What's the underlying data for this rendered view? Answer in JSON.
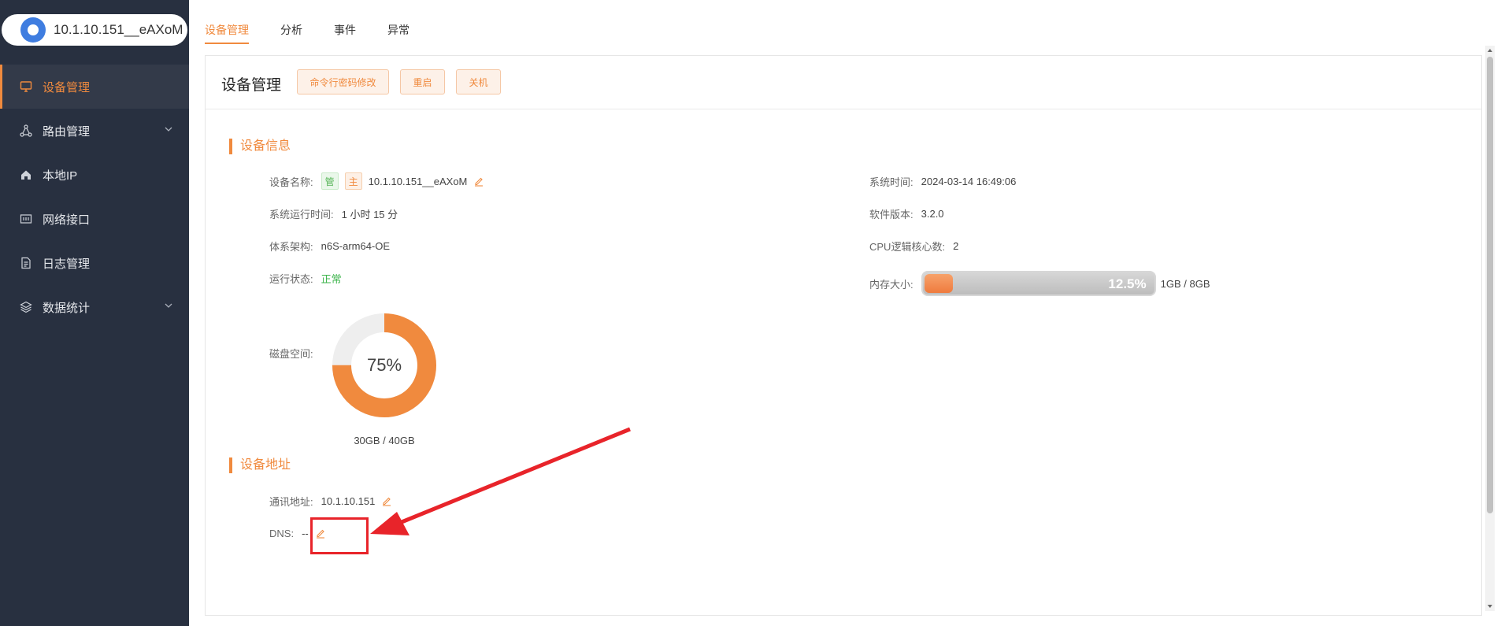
{
  "window": {
    "title": "10.1.10.151__eAXoM"
  },
  "sidebar": {
    "brand_title": "10.1.10.151__eAXoM",
    "items": [
      {
        "label": "设备管理",
        "icon": "monitor-icon",
        "active": true
      },
      {
        "label": "路由管理",
        "icon": "route-icon",
        "expandable": true
      },
      {
        "label": "本地IP",
        "icon": "home-icon"
      },
      {
        "label": "网络接口",
        "icon": "interface-icon"
      },
      {
        "label": "日志管理",
        "icon": "document-icon"
      },
      {
        "label": "数据统计",
        "icon": "layers-icon",
        "expandable": true
      }
    ]
  },
  "tabs": [
    {
      "label": "设备管理",
      "active": true
    },
    {
      "label": "分析"
    },
    {
      "label": "事件"
    },
    {
      "label": "异常"
    }
  ],
  "card": {
    "title": "设备管理",
    "buttons": {
      "cli_password": "命令行密码修改",
      "restart": "重启",
      "shutdown": "关机"
    }
  },
  "device_info": {
    "section_title": "设备信息",
    "name_label": "设备名称:",
    "tag_manage": "管",
    "tag_master": "主",
    "name_value": "10.1.10.151__eAXoM",
    "uptime_label": "系统运行时间:",
    "uptime_value": "1 小时 15 分",
    "arch_label": "体系架构:",
    "arch_value": "n6S-arm64-OE",
    "status_label": "运行状态:",
    "status_value": "正常",
    "system_time_label": "系统时间:",
    "system_time_value": "2024-03-14 16:49:06",
    "software_version_label": "软件版本:",
    "software_version_value": "3.2.0",
    "cpu_cores_label": "CPU逻辑核心数:",
    "cpu_cores_value": "2",
    "memory_label": "内存大小:",
    "memory_percent_text": "12.5%",
    "memory_fraction": 0.125,
    "memory_usage_text": "1GB / 8GB",
    "disk_label": "磁盘空间:",
    "disk_percent_text": "75%",
    "disk_fraction": 0.75,
    "disk_usage_text": "30GB / 40GB"
  },
  "device_address": {
    "section_title": "设备地址",
    "comm_label": "通讯地址:",
    "comm_value": "10.1.10.151",
    "dns_label": "DNS:",
    "dns_value": "--"
  },
  "colors": {
    "accent": "#f08a3e",
    "sidebar_bg": "#283040",
    "status_ok": "#3cb44b",
    "annotation_red": "#e8242a"
  }
}
